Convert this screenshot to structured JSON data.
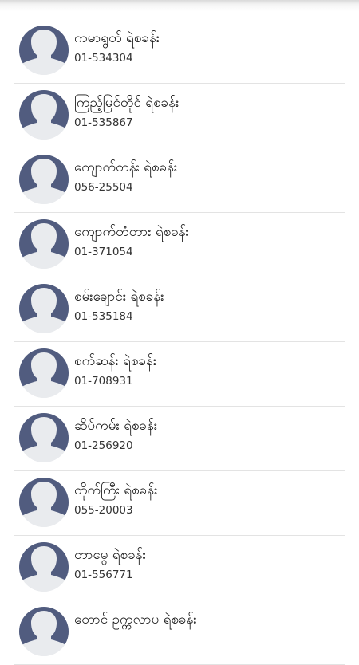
{
  "contacts": [
    {
      "name": "ကမာရွတ် ရဲစခန်း",
      "phone": "01-534304",
      "avatar_icon": "person-avatar-icon"
    },
    {
      "name": "ကြည့်မြင်တိုင် ရဲစခန်း",
      "phone": "01-535867",
      "avatar_icon": "person-avatar-icon"
    },
    {
      "name": "ကျောက်တန်း ရဲစခန်း",
      "phone": "056-25504",
      "avatar_icon": "person-avatar-icon"
    },
    {
      "name": "ကျောက်တံတား ရဲစခန်း",
      "phone": "01-371054",
      "avatar_icon": "person-avatar-icon"
    },
    {
      "name": "စမ်းချောင်း ရဲစခန်း",
      "phone": "01-535184",
      "avatar_icon": "person-avatar-icon"
    },
    {
      "name": "စက်ဆန်း ရဲစခန်း",
      "phone": "01-708931",
      "avatar_icon": "person-avatar-icon"
    },
    {
      "name": "ဆိပ်ကမ်း ရဲစခန်း",
      "phone": "01-256920",
      "avatar_icon": "person-avatar-icon"
    },
    {
      "name": "တိုက်ကြီး ရဲစခန်း",
      "phone": "055-20003",
      "avatar_icon": "person-avatar-icon"
    },
    {
      "name": "တာမွေ ရဲစခန်း",
      "phone": "01-556771",
      "avatar_icon": "person-avatar-icon"
    },
    {
      "name": "တောင် ဥက္ကလာပ ရဲစခန်း",
      "phone": "",
      "avatar_icon": "person-avatar-icon"
    }
  ],
  "colors": {
    "avatar_body": "#515c7f",
    "avatar_bg": "#e9ebee",
    "divider": "#e3e3e3"
  }
}
